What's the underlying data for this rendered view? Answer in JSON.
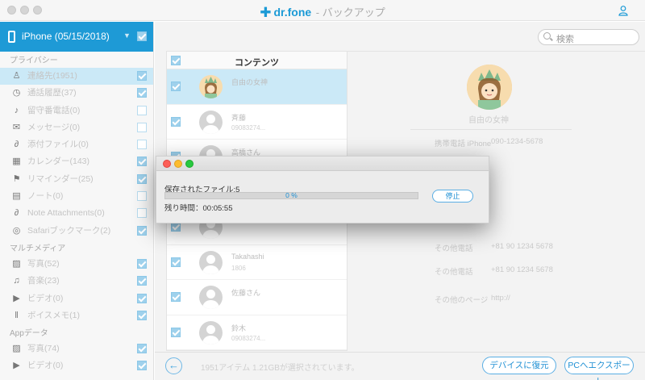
{
  "app": {
    "brand": "dr.fone",
    "subtitle": " - バックアップ"
  },
  "device": {
    "name": "iPhone (05/15/2018)"
  },
  "sidebar": {
    "sections": [
      {
        "label": "プライバシー",
        "items": [
          {
            "label": "連絡先(1951)",
            "icon": "person-icon",
            "checked": true,
            "active": true
          },
          {
            "label": "通話履歴(37)",
            "icon": "clock-icon",
            "checked": true
          },
          {
            "label": "留守番電話(0)",
            "icon": "microphone-icon",
            "checked": false
          },
          {
            "label": "メッセージ(0)",
            "icon": "message-icon",
            "checked": false
          },
          {
            "label": "添付ファイル(0)",
            "icon": "paperclip-icon",
            "checked": false
          },
          {
            "label": "カレンダー(143)",
            "icon": "calendar-icon",
            "checked": true
          },
          {
            "label": "リマインダー(25)",
            "icon": "flag-icon",
            "checked": true
          },
          {
            "label": "ノート(0)",
            "icon": "note-icon",
            "checked": false
          },
          {
            "label": "Note Attachments(0)",
            "icon": "paperclip-icon",
            "checked": false
          },
          {
            "label": "Safariブックマーク(2)",
            "icon": "compass-icon",
            "checked": true
          }
        ]
      },
      {
        "label": "マルチメディア",
        "items": [
          {
            "label": "写真(52)",
            "icon": "photo-icon",
            "checked": true
          },
          {
            "label": "音楽(23)",
            "icon": "music-icon",
            "checked": true
          },
          {
            "label": "ビデオ(0)",
            "icon": "video-icon",
            "checked": true
          },
          {
            "label": "ボイスメモ(1)",
            "icon": "waveform-icon",
            "checked": true
          }
        ]
      },
      {
        "label": "Appデータ",
        "items": [
          {
            "label": "写真(74)",
            "icon": "photo-icon",
            "checked": true
          },
          {
            "label": "ビデオ(0)",
            "icon": "video-icon",
            "checked": true
          }
        ]
      }
    ]
  },
  "search": {
    "placeholder": "検索"
  },
  "list": {
    "header": "コンテンツ",
    "rows": [
      {
        "name": "自由の女神",
        "phone": "",
        "selected": true,
        "checked": true,
        "statue": true
      },
      {
        "name": "斉藤",
        "phone": "09083274...",
        "checked": true
      },
      {
        "name": "高橋さん",
        "phone": "",
        "checked": true
      },
      {
        "name": "",
        "phone": "",
        "checked": true
      },
      {
        "name": "",
        "phone": "",
        "checked": true
      },
      {
        "name": "Takahashi",
        "phone": "1806",
        "checked": true
      },
      {
        "name": "佐藤さん",
        "phone": "",
        "checked": true
      },
      {
        "name": "鈴木",
        "phone": "09083274...",
        "checked": true
      }
    ]
  },
  "detail": {
    "name": "自由の女神",
    "fields": [
      {
        "label": "携帯電話 iPhone",
        "value": "090-1234-5678"
      },
      {
        "label": "その他電話",
        "value": "+81 90 1234 5678"
      },
      {
        "label": "その他電話",
        "value": "+81 90 1234 5678"
      },
      {
        "label": "その他のページ",
        "value": "http://"
      }
    ]
  },
  "footer": {
    "status": "1951アイテム 1.21GBが選択されています。",
    "restore_button": "デバイスに復元",
    "export_button": "PCへエクスポート"
  },
  "dialog": {
    "saved": "保存されたファイル:5",
    "progress": 0,
    "progress_text": "0 %",
    "remaining": "残り時間：00:05:55",
    "stop_button": "停止"
  },
  "colors": {
    "accent": "#1e9ad6",
    "selected_row": "#cbe9f7",
    "checkbox_on": "#9fd1ec"
  }
}
